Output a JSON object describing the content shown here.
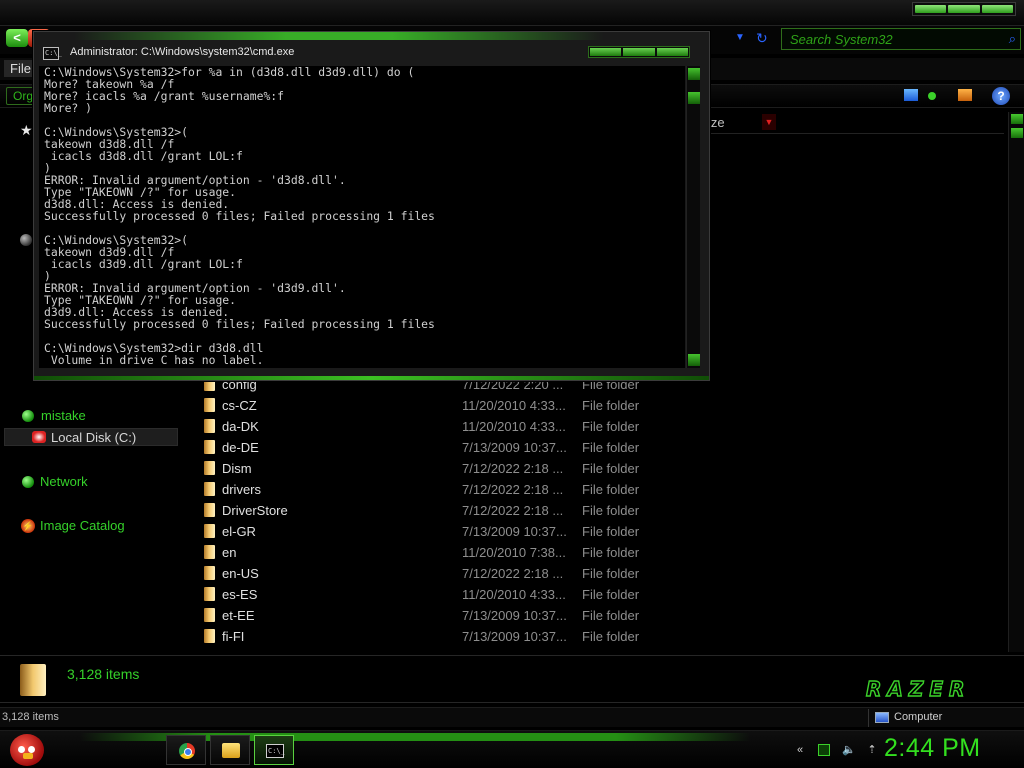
{
  "explorer": {
    "search_placeholder": "Search System32",
    "menu_file": "File",
    "organize_label": "Org",
    "column_size": "ize",
    "sidebar": {
      "mistake": "mistake",
      "local_disk": "Local Disk (C:)",
      "network": "Network",
      "image_catalog": "Image Catalog"
    },
    "files": [
      {
        "name": "config",
        "date": "7/12/2022 2:20 ...",
        "type": "File folder"
      },
      {
        "name": "cs-CZ",
        "date": "11/20/2010 4:33...",
        "type": "File folder"
      },
      {
        "name": "da-DK",
        "date": "11/20/2010 4:33...",
        "type": "File folder"
      },
      {
        "name": "de-DE",
        "date": "7/13/2009 10:37...",
        "type": "File folder"
      },
      {
        "name": "Dism",
        "date": "7/12/2022 2:18 ...",
        "type": "File folder"
      },
      {
        "name": "drivers",
        "date": "7/12/2022 2:18 ...",
        "type": "File folder"
      },
      {
        "name": "DriverStore",
        "date": "7/12/2022 2:18 ...",
        "type": "File folder"
      },
      {
        "name": "el-GR",
        "date": "7/13/2009 10:37...",
        "type": "File folder"
      },
      {
        "name": "en",
        "date": "11/20/2010 7:38...",
        "type": "File folder"
      },
      {
        "name": "en-US",
        "date": "7/12/2022 2:18 ...",
        "type": "File folder"
      },
      {
        "name": "es-ES",
        "date": "11/20/2010 4:33...",
        "type": "File folder"
      },
      {
        "name": "et-EE",
        "date": "7/13/2009 10:37...",
        "type": "File folder"
      },
      {
        "name": "fi-FI",
        "date": "7/13/2009 10:37...",
        "type": "File folder"
      }
    ],
    "details_count": "3,128 items",
    "status_items": "3,128 items",
    "status_computer": "Computer",
    "logo_text": "RAZER"
  },
  "cmd": {
    "title": "Administrator: C:\\Windows\\system32\\cmd.exe",
    "icon_text": "C:\\_",
    "lines": [
      "C:\\Windows\\System32>for %a in (d3d8.dll d3d9.dll) do (",
      "More? takeown %a /f",
      "More? icacls %a /grant %username%:f",
      "More? )",
      "",
      "C:\\Windows\\System32>(",
      "takeown d3d8.dll /f",
      " icacls d3d8.dll /grant LOL:f",
      ")",
      "ERROR: Invalid argument/option - 'd3d8.dll'.",
      "Type \"TAKEOWN /?\" for usage.",
      "d3d8.dll: Access is denied.",
      "Successfully processed 0 files; Failed processing 1 files",
      "",
      "C:\\Windows\\System32>(",
      "takeown d3d9.dll /f",
      " icacls d3d9.dll /grant LOL:f",
      ")",
      "ERROR: Invalid argument/option - 'd3d9.dll'.",
      "Type \"TAKEOWN /?\" for usage.",
      "d3d9.dll: Access is denied.",
      "Successfully processed 0 files; Failed processing 1 files",
      "",
      "C:\\Windows\\System32>dir d3d8.dll",
      " Volume in drive C has no label."
    ]
  },
  "taskbar": {
    "clock": "2:44 PM",
    "cmd_task_text": "C:\\_"
  },
  "colors": {
    "accent_green": "#35d12a",
    "clock_green": "#33e01f"
  }
}
